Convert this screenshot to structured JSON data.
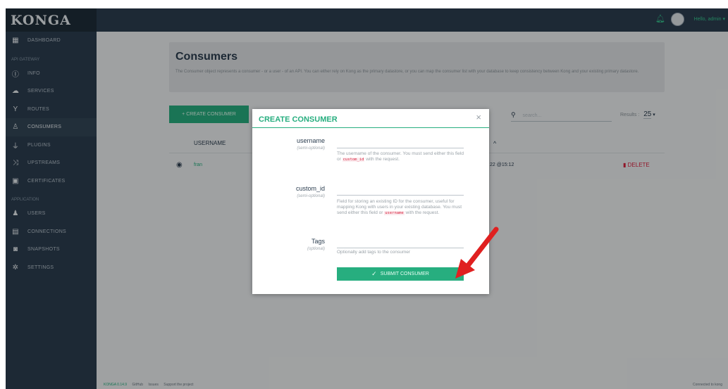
{
  "app": {
    "logo": "KONGA"
  },
  "sidebar": {
    "items": [
      {
        "label": "DASHBOARD",
        "icon": "dashboard-icon"
      },
      {
        "section": "API GATEWAY"
      },
      {
        "label": "INFO",
        "icon": "info-icon"
      },
      {
        "label": "SERVICES",
        "icon": "cloud-icon"
      },
      {
        "label": "ROUTES",
        "icon": "routes-icon"
      },
      {
        "label": "CONSUMERS",
        "icon": "users-icon",
        "active": true
      },
      {
        "label": "PLUGINS",
        "icon": "plug-icon"
      },
      {
        "label": "UPSTREAMS",
        "icon": "shuffle-icon"
      },
      {
        "label": "CERTIFICATES",
        "icon": "certificate-icon"
      },
      {
        "section": "APPLICATION"
      },
      {
        "label": "USERS",
        "icon": "group-icon"
      },
      {
        "label": "CONNECTIONS",
        "icon": "connection-icon"
      },
      {
        "label": "SNAPSHOTS",
        "icon": "camera-icon"
      },
      {
        "label": "SETTINGS",
        "icon": "gear-icon"
      }
    ]
  },
  "topbar": {
    "greeting": "Hello, admin",
    "bell_icon": "bell-icon",
    "accent": "#36c48e"
  },
  "page": {
    "title": "Consumers",
    "description": "The Consumer object represents a consumer - or a user - of an API. You can either rely on Kong as the primary datastore, or you can map the consumer list with your database to keep consistency between Kong and your existing primary datastore.",
    "create_button": "+ CREATE CONSUMER",
    "search_placeholder": "search...",
    "results_label": "Results :",
    "results_value": "25",
    "table": {
      "columns": [
        "USERNAME"
      ],
      "rows": [
        {
          "username": "fran",
          "created": "22 @15:12",
          "action": "DELETE"
        }
      ]
    }
  },
  "footer": {
    "version": "KONGA 0.14.9",
    "links": [
      "GitHub",
      "Issues",
      "Support the project"
    ],
    "status": "Connected to kong"
  },
  "modal": {
    "title": "CREATE CONSUMER",
    "close": "×",
    "fields": [
      {
        "name": "username",
        "sub": "(semi-optional)",
        "help_pre": "The username of the consumer. You must send either this field or",
        "help_code": "custom_id",
        "help_post": "with the request."
      },
      {
        "name": "custom_id",
        "sub": "(semi-optional)",
        "help_pre": "Field for storing an existing ID for the consumer, useful for mapping Kong with users in your existing database. You must send either this field or",
        "help_code": "username",
        "help_post": "with the request."
      },
      {
        "name": "Tags",
        "sub": "(optional)",
        "help_pre": "Optionally add tags to the consumer"
      }
    ],
    "submit": "SUBMIT CONSUMER",
    "brand_color": "#27ae7f"
  },
  "annotation": {
    "arrow_color": "#e02020"
  }
}
